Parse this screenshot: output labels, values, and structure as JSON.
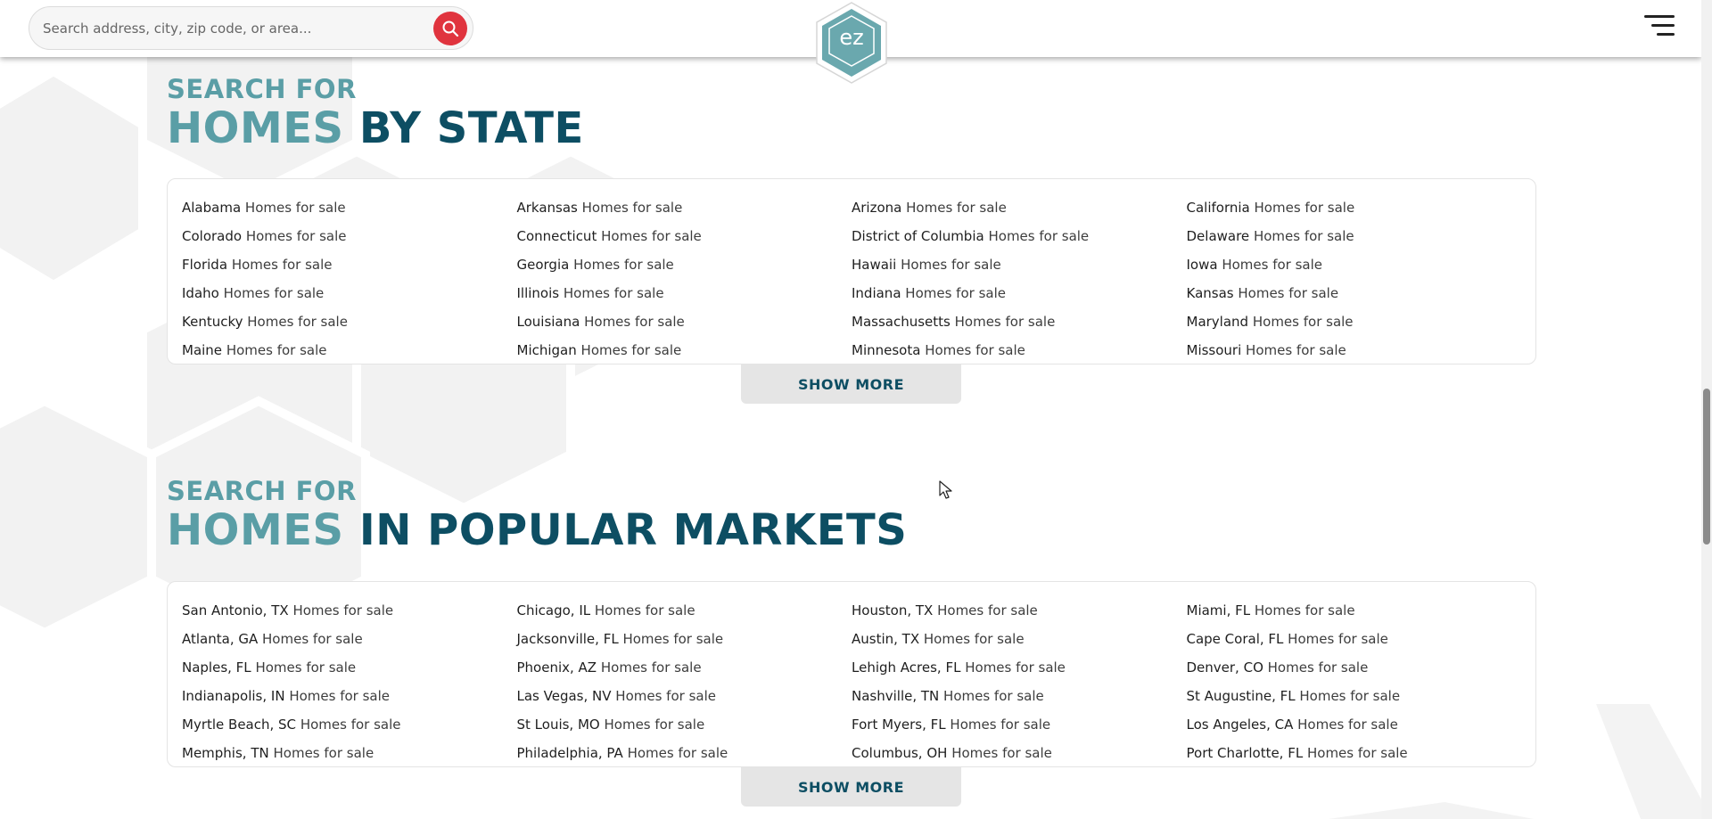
{
  "search": {
    "placeholder": "Search address, city, zip code, or area..."
  },
  "logo": {
    "text": "ez"
  },
  "colors": {
    "accent_light": "#5a9ea6",
    "accent_dark": "#0d4e63",
    "search_button": "#e0343e"
  },
  "states_section": {
    "eyebrow": "SEARCH FOR",
    "headline_light": "HOMES",
    "headline_dark": "BY STATE",
    "show_more": "SHOW MORE",
    "items": [
      {
        "place": "Alabama",
        "suffix": "Homes for sale"
      },
      {
        "place": "Arkansas",
        "suffix": "Homes for sale"
      },
      {
        "place": "Arizona",
        "suffix": "Homes for sale"
      },
      {
        "place": "California",
        "suffix": "Homes for sale"
      },
      {
        "place": "Colorado",
        "suffix": "Homes for sale"
      },
      {
        "place": "Connecticut",
        "suffix": "Homes for sale"
      },
      {
        "place": "District of Columbia",
        "suffix": "Homes for sale"
      },
      {
        "place": "Delaware",
        "suffix": "Homes for sale"
      },
      {
        "place": "Florida",
        "suffix": "Homes for sale"
      },
      {
        "place": "Georgia",
        "suffix": "Homes for sale"
      },
      {
        "place": "Hawaii",
        "suffix": "Homes for sale"
      },
      {
        "place": "Iowa",
        "suffix": "Homes for sale"
      },
      {
        "place": "Idaho",
        "suffix": "Homes for sale"
      },
      {
        "place": "Illinois",
        "suffix": "Homes for sale"
      },
      {
        "place": "Indiana",
        "suffix": "Homes for sale"
      },
      {
        "place": "Kansas",
        "suffix": "Homes for sale"
      },
      {
        "place": "Kentucky",
        "suffix": "Homes for sale"
      },
      {
        "place": "Louisiana",
        "suffix": "Homes for sale"
      },
      {
        "place": "Massachusetts",
        "suffix": "Homes for sale"
      },
      {
        "place": "Maryland",
        "suffix": "Homes for sale"
      },
      {
        "place": "Maine",
        "suffix": "Homes for sale"
      },
      {
        "place": "Michigan",
        "suffix": "Homes for sale"
      },
      {
        "place": "Minnesota",
        "suffix": "Homes for sale"
      },
      {
        "place": "Missouri",
        "suffix": "Homes for sale"
      }
    ]
  },
  "markets_section": {
    "eyebrow": "SEARCH FOR",
    "headline_light": "HOMES",
    "headline_dark": "IN POPULAR MARKETS",
    "show_more": "SHOW MORE",
    "items": [
      {
        "place": "San Antonio, TX",
        "suffix": "Homes for sale"
      },
      {
        "place": "Chicago, IL",
        "suffix": "Homes for sale"
      },
      {
        "place": "Houston, TX",
        "suffix": "Homes for sale"
      },
      {
        "place": "Miami, FL",
        "suffix": "Homes for sale"
      },
      {
        "place": "Atlanta, GA",
        "suffix": "Homes for sale"
      },
      {
        "place": "Jacksonville, FL",
        "suffix": "Homes for sale"
      },
      {
        "place": "Austin, TX",
        "suffix": "Homes for sale"
      },
      {
        "place": "Cape Coral, FL",
        "suffix": "Homes for sale"
      },
      {
        "place": "Naples, FL",
        "suffix": "Homes for sale"
      },
      {
        "place": "Phoenix, AZ",
        "suffix": "Homes for sale"
      },
      {
        "place": "Lehigh Acres, FL",
        "suffix": "Homes for sale"
      },
      {
        "place": "Denver, CO",
        "suffix": "Homes for sale"
      },
      {
        "place": "Indianapolis, IN",
        "suffix": "Homes for sale"
      },
      {
        "place": "Las Vegas, NV",
        "suffix": "Homes for sale"
      },
      {
        "place": "Nashville, TN",
        "suffix": "Homes for sale"
      },
      {
        "place": "St Augustine, FL",
        "suffix": "Homes for sale"
      },
      {
        "place": "Myrtle Beach, SC",
        "suffix": "Homes for sale"
      },
      {
        "place": "St Louis, MO",
        "suffix": "Homes for sale"
      },
      {
        "place": "Fort Myers, FL",
        "suffix": "Homes for sale"
      },
      {
        "place": "Los Angeles, CA",
        "suffix": "Homes for sale"
      },
      {
        "place": "Memphis, TN",
        "suffix": "Homes for sale"
      },
      {
        "place": "Philadelphia, PA",
        "suffix": "Homes for sale"
      },
      {
        "place": "Columbus, OH",
        "suffix": "Homes for sale"
      },
      {
        "place": "Port Charlotte, FL",
        "suffix": "Homes for sale"
      }
    ]
  }
}
